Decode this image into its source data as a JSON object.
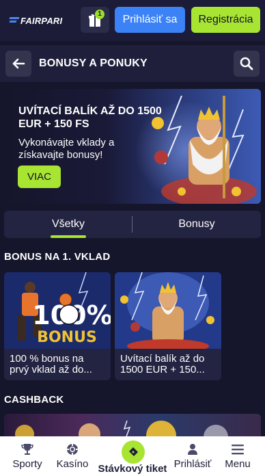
{
  "topbar": {
    "logo_text": "FAIRPARI",
    "gift_badge": "1",
    "login_label": "Prihlásiť sa",
    "register_label": "Registrácia"
  },
  "header": {
    "title": "BONUSY A PONUKY"
  },
  "hero": {
    "title": "UVÍTACÍ BALÍK AŽ DO 1500 EUR + 150 FS",
    "subtitle": "Vykonávajte vklady a získavajte bonusy!",
    "button_label": "VIAC"
  },
  "tabs": [
    {
      "label": "Všetky",
      "active": true
    },
    {
      "label": "Bonusy",
      "active": false
    }
  ],
  "sections": {
    "first_deposit_title": "BONUS NA 1. VKLAD",
    "cashback_title": "CASHBACK"
  },
  "cards": [
    {
      "line1": "100 % bonus na",
      "line2": "prvý vklad až do...",
      "art_text": "100%",
      "art_sub": "BONUS"
    },
    {
      "line1": "Uvítací balík až do",
      "line2": "1500 EUR + 150..."
    }
  ],
  "bottom_nav": [
    {
      "label": "Sporty",
      "icon": "trophy-icon"
    },
    {
      "label": "Kasíno",
      "icon": "casino-chip-icon"
    },
    {
      "label": "Stávkový tiket",
      "icon": "ticket-icon"
    },
    {
      "label": "Prihlásiť",
      "icon": "user-icon"
    },
    {
      "label": "Menu",
      "icon": "hamburger-icon"
    }
  ],
  "colors": {
    "background": "#15152b",
    "accent_green": "#a8e432",
    "accent_blue": "#3b82f6"
  }
}
